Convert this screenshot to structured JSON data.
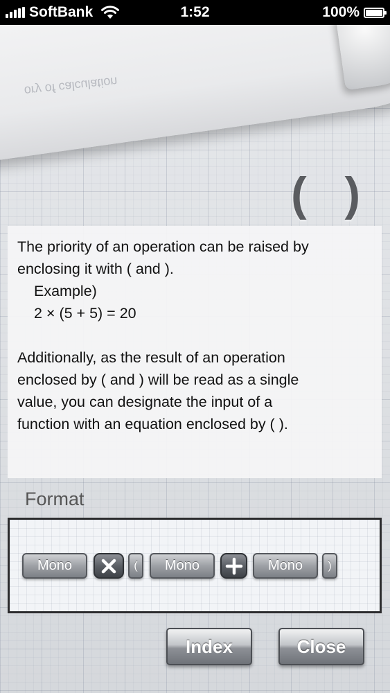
{
  "status_bar": {
    "carrier": "SoftBank",
    "time": "1:52",
    "battery": "100%"
  },
  "curl": {
    "ghost_text": "ory of calculation"
  },
  "page": {
    "heading": "( )",
    "description": {
      "line1": "The priority of an operation can be raised by",
      "line2": "enclosing it with ( and ).",
      "example_label": "Example)",
      "example_expr": "2 × (5 + 5) = 20",
      "para2_line1": "Additionally, as the result of an operation",
      "para2_line2": "enclosed by ( and ) will be read as a single",
      "para2_line3": "value, you can designate the input of a",
      "para2_line4": "function with an equation enclosed by ( )."
    },
    "format_label": "Format",
    "format_tokens": {
      "mono1": "Mono",
      "open_paren": "(",
      "mono2": "Mono",
      "mono3": "Mono",
      "close_paren": ")"
    },
    "buttons": {
      "index": "Index",
      "close": "Close"
    }
  },
  "icons": {
    "multiply": "multiply-icon",
    "plus": "plus-icon",
    "wifi": "wifi-icon",
    "signal": "signal-icon",
    "battery": "battery-icon"
  }
}
